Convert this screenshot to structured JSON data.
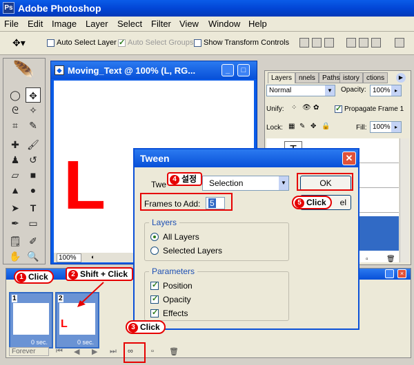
{
  "app": {
    "title": "Adobe Photoshop"
  },
  "menu": [
    "File",
    "Edit",
    "Image",
    "Layer",
    "Select",
    "Filter",
    "View",
    "Window",
    "Help"
  ],
  "options": {
    "auto_select_layer": "Auto Select Layer",
    "auto_select_groups": "Auto Select Groups",
    "show_transform": "Show Transform Controls"
  },
  "document": {
    "title": "Moving_Text @ 100% (L, RG...",
    "canvas_letter": "L",
    "zoom": "100%"
  },
  "layers": {
    "tabs": [
      "Layers",
      "nnels",
      "Paths",
      "istory",
      "ctions"
    ],
    "blend_mode": "Normal",
    "opacity_label": "Opacity:",
    "opacity_value": "100%",
    "unify_label": "Unify:",
    "propagate_label": "Propagate Frame 1",
    "lock_label": "Lock:",
    "fill_label": "Fill:",
    "fill_value": "100%",
    "text_layer_icon": "T"
  },
  "animation": {
    "frames": [
      {
        "num": "1",
        "delay": "0 sec.",
        "letter": ""
      },
      {
        "num": "2",
        "delay": "0 sec.",
        "letter": "L"
      }
    ],
    "loop": "Forever"
  },
  "tween": {
    "title": "Tween",
    "tween_with_label": "Twe",
    "tween_with_value": "Selection",
    "frames_to_add_label": "Frames to Add:",
    "frames_to_add_value": "5",
    "ok_label": "OK",
    "cancel_label": "el",
    "layers_group": "Layers",
    "all_layers": "All Layers",
    "selected_layers": "Selected Layers",
    "parameters_group": "Parameters",
    "position": "Position",
    "opacity": "Opacity",
    "effects": "Effects"
  },
  "annotations": {
    "step1": {
      "num": "1",
      "text": "Click"
    },
    "step2": {
      "num": "2",
      "text": "Shift + Click"
    },
    "step3": {
      "num": "3",
      "text": "Click"
    },
    "step4": {
      "num": "4",
      "text": "설정"
    },
    "step5": {
      "num": "5",
      "text": "Click"
    }
  },
  "colors": {
    "accent": "#0a5ce8",
    "annotation": "#e60000",
    "selection": "#316ac5"
  }
}
